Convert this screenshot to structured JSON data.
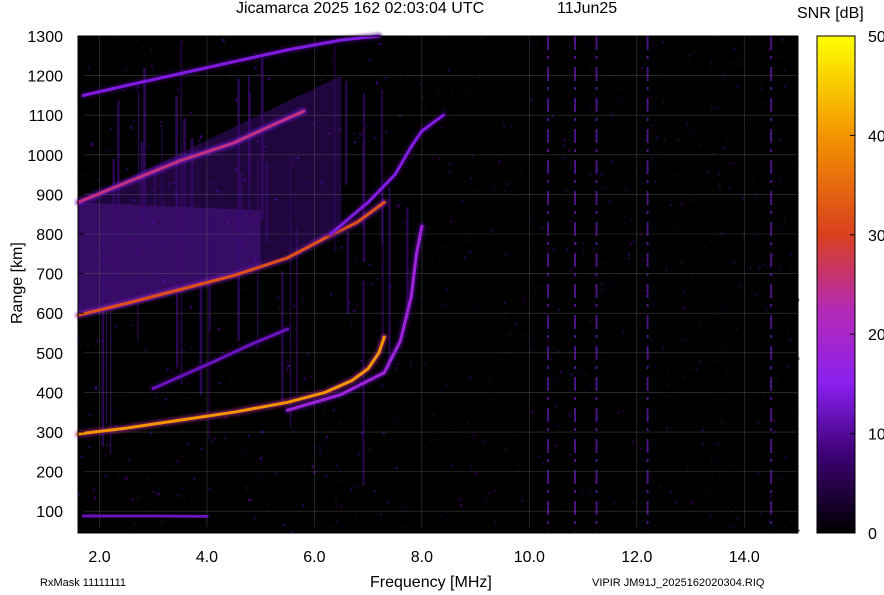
{
  "header": {
    "title": "Jicamarca 2025 162 02:03:04 UTC",
    "date": "11Jun25"
  },
  "footer": {
    "rxmask": "RxMask 11111111",
    "file": "VIPIR  JM91J_2025162020304.RIQ"
  },
  "colorbar": {
    "label": "SNR [dB]",
    "ticks": [
      "0",
      "10",
      "20",
      "30",
      "40",
      "50"
    ],
    "range": [
      0,
      50
    ],
    "colors": [
      "#000000",
      "#3a006e",
      "#8a1ff0",
      "#b52ab4",
      "#d8401e",
      "#f39400",
      "#ffff00"
    ]
  },
  "chart_data": {
    "type": "heatmap",
    "title": "Jicamarca 2025 162 02:03:04 UTC",
    "xlabel": "Frequency [MHz]",
    "ylabel": "Range [km]",
    "xlim": [
      1.6,
      15.0
    ],
    "ylim": [
      45,
      1300
    ],
    "xticks": [
      "2.0",
      "4.0",
      "6.0",
      "8.0",
      "10.0",
      "12.0",
      "14.0"
    ],
    "xtick_values": [
      2,
      4,
      6,
      8,
      10,
      12,
      14
    ],
    "yticks": [
      "100",
      "200",
      "300",
      "400",
      "500",
      "600",
      "700",
      "800",
      "900",
      "1000",
      "1100",
      "1200",
      "1300"
    ],
    "ytick_values": [
      100,
      200,
      300,
      400,
      500,
      600,
      700,
      800,
      900,
      1000,
      1100,
      1200,
      1300
    ],
    "grid": true,
    "colorbar_label": "SNR [dB]",
    "traces": [
      {
        "x": [
          1.6,
          2.5,
          3.5,
          4.5,
          5.5,
          6.2,
          6.7,
          7.0,
          7.2,
          7.3
        ],
        "y": [
          295,
          310,
          330,
          350,
          375,
          400,
          430,
          460,
          500,
          540
        ],
        "snr": 40
      },
      {
        "x": [
          1.6,
          2.5,
          3.5,
          4.5,
          5.5,
          6.2,
          6.8,
          7.3
        ],
        "y": [
          595,
          625,
          660,
          695,
          740,
          790,
          830,
          880
        ],
        "snr": 32
      },
      {
        "x": [
          1.6,
          2.5,
          3.5,
          4.5,
          5.3,
          5.8
        ],
        "y": [
          880,
          930,
          985,
          1030,
          1080,
          1110
        ],
        "snr": 25
      },
      {
        "x": [
          1.7,
          2.5,
          3.5,
          4.5,
          5.5,
          6.5,
          7.2
        ],
        "y": [
          1150,
          1175,
          1205,
          1235,
          1265,
          1290,
          1300
        ],
        "snr": 14
      },
      {
        "x": [
          5.5,
          6.5,
          7.3,
          7.6,
          7.8,
          7.9,
          8.0
        ],
        "y": [
          355,
          395,
          450,
          530,
          640,
          750,
          820
        ],
        "snr": 18
      },
      {
        "x": [
          6.3,
          7.0,
          7.5,
          7.8,
          8.0,
          8.2,
          8.4
        ],
        "y": [
          800,
          880,
          950,
          1020,
          1060,
          1080,
          1100
        ],
        "snr": 14
      },
      {
        "x": [
          3.0,
          4.0,
          4.8,
          5.5
        ],
        "y": [
          410,
          470,
          520,
          560
        ],
        "snr": 12
      },
      {
        "x": [
          1.7,
          3.0,
          4.0
        ],
        "y": [
          88,
          88,
          87
        ],
        "snr": 12
      }
    ],
    "vertical_lines_mhz": [
      10.35,
      10.85,
      11.25,
      12.2,
      14.5
    ]
  }
}
